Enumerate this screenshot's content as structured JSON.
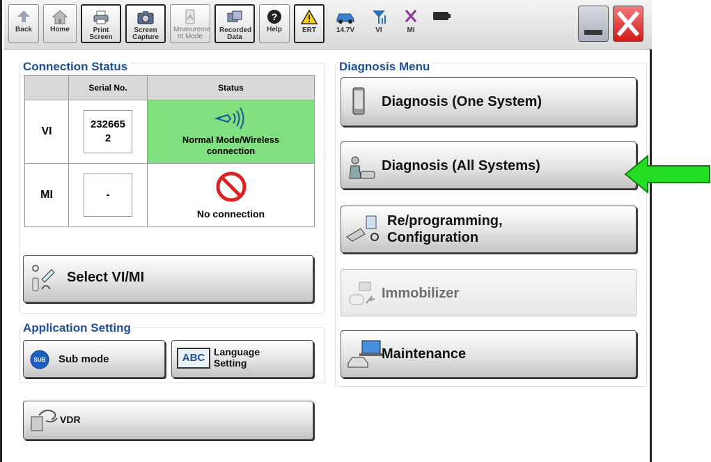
{
  "toolbar": {
    "back": "Back",
    "home": "Home",
    "print_screen": "Print Screen",
    "screen_capture": "Screen Capture",
    "measurement_mode": "Measureme nt Mode",
    "recorded_data": "Recorded Data",
    "help": "Help",
    "ert": "ERT",
    "battery_voltage": "14.7V",
    "vi": "VI",
    "mi": "MI"
  },
  "connection_status": {
    "title": "Connection Status",
    "headers": {
      "serial": "Serial No.",
      "status": "Status"
    },
    "rows": [
      {
        "device": "VI",
        "serial": "2326652",
        "status": "Normal Mode/Wireless connection",
        "status_color": "#7fe07f"
      },
      {
        "device": "MI",
        "serial": "-",
        "status": "No connection"
      }
    ]
  },
  "select_vimi": {
    "label": "Select VI/MI"
  },
  "application_setting": {
    "title": "Application Setting",
    "sub_mode": "Sub mode",
    "sub_badge": "SUB",
    "language": "Language Setting",
    "language_badge": "ABC",
    "vdr": "VDR"
  },
  "diagnosis_menu": {
    "title": "Diagnosis Menu",
    "one_system": "Diagnosis (One System)",
    "all_systems": "Diagnosis (All Systems)",
    "reprogramming_line1": "Re/programming,",
    "reprogramming_line2": "Configuration",
    "immobilizer": "Immobilizer",
    "maintenance": "Maintenance"
  },
  "colors": {
    "accent_blue": "#1f4e9a",
    "status_green": "#7fe07f",
    "arrow_green": "#22dd22",
    "close_red": "#e02020"
  },
  "icons": [
    "back-arrow-icon",
    "home-icon",
    "printer-icon",
    "camera-icon",
    "gauge-icon",
    "recorded-data-icon",
    "help-icon",
    "warning-icon",
    "car-icon",
    "signal-icon",
    "mi-x-icon",
    "battery-icon",
    "minimize-icon",
    "close-icon",
    "wireless-icon",
    "prohibited-icon",
    "phone-icon",
    "mechanic-icon",
    "connector-icon",
    "immobilizer-icon",
    "laptop-car-icon",
    "select-vimi-icon",
    "vdr-icon"
  ]
}
